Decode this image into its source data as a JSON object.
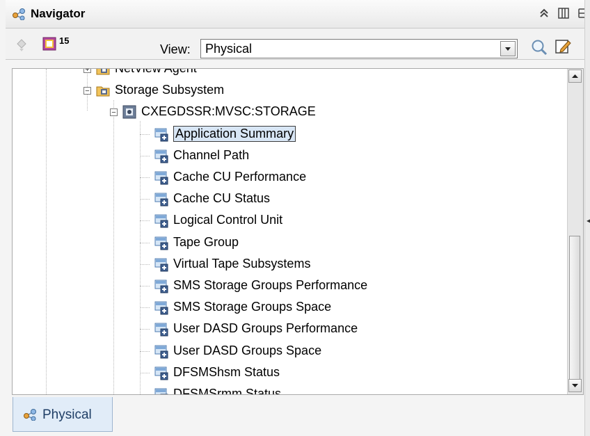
{
  "window": {
    "title": "Navigator",
    "buttons": [
      "collapse-icon",
      "split-vertical-icon",
      "split-horizontal-icon"
    ]
  },
  "toolbar": {
    "badge_count": "15",
    "view_label": "View:",
    "view_value": "Physical"
  },
  "tree": {
    "nodes": [
      {
        "label": "NetView Agent",
        "level": 1,
        "icon": "folder-icon",
        "expander": "+"
      },
      {
        "label": "Storage Subsystem",
        "level": 1,
        "icon": "folder-icon",
        "expander": "−"
      },
      {
        "label": "CXEGDSSR:MVSC:STORAGE",
        "level": 2,
        "icon": "agent-icon",
        "expander": "−"
      },
      {
        "label": "Application Summary",
        "level": 3,
        "icon": "workspace-icon",
        "selected": true
      },
      {
        "label": "Channel Path",
        "level": 3,
        "icon": "workspace-icon"
      },
      {
        "label": "Cache CU Performance",
        "level": 3,
        "icon": "workspace-icon"
      },
      {
        "label": "Cache CU Status",
        "level": 3,
        "icon": "workspace-icon"
      },
      {
        "label": "Logical Control Unit",
        "level": 3,
        "icon": "workspace-icon"
      },
      {
        "label": "Tape Group",
        "level": 3,
        "icon": "workspace-icon"
      },
      {
        "label": "Virtual Tape Subsystems",
        "level": 3,
        "icon": "workspace-icon"
      },
      {
        "label": "SMS Storage Groups Performance",
        "level": 3,
        "icon": "workspace-icon"
      },
      {
        "label": "SMS Storage Groups Space",
        "level": 3,
        "icon": "workspace-icon"
      },
      {
        "label": "User DASD Groups Performance",
        "level": 3,
        "icon": "workspace-icon"
      },
      {
        "label": "User DASD Groups Space",
        "level": 3,
        "icon": "workspace-icon"
      },
      {
        "label": "DFSMShsm Status",
        "level": 3,
        "icon": "workspace-icon"
      },
      {
        "label": "DFSMSrmm Status",
        "level": 3,
        "icon": "workspace-icon"
      }
    ]
  },
  "bottom_tab": {
    "label": "Physical"
  }
}
